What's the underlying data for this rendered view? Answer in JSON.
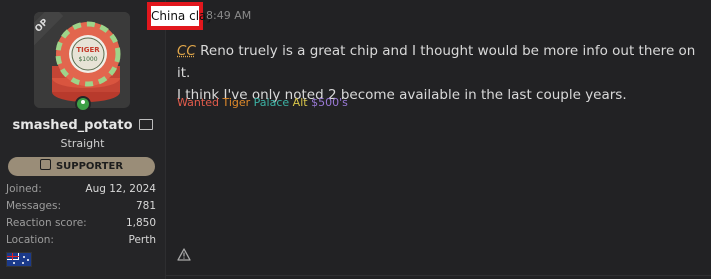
{
  "user": {
    "username": "smashed_potato",
    "title": "Straight",
    "op_label": "OP",
    "badge": "SUPPORTER",
    "stats": [
      {
        "label": "Joined:",
        "value": "Aug 12, 2024"
      },
      {
        "label": "Messages:",
        "value": "781"
      },
      {
        "label": "Reaction score:",
        "value": "1,850"
      },
      {
        "label": "Location:",
        "value": "Perth"
      }
    ],
    "flag": "australia-flag",
    "online": true
  },
  "post": {
    "tag": "China clay",
    "timestamp": "8:49 AM",
    "mention": "CC",
    "body_line1": " Reno truely is a great chip and I thought would be more info out there on it.",
    "body_line2": "I think I've only noted 2 become available in the last couple years.",
    "signature": {
      "wanted": "Wanted",
      "tiger": "Tiger",
      "palace": "Palace",
      "alt": "Alt",
      "price": "$500's"
    }
  },
  "colors": {
    "tag_border": "#e2171d",
    "badge_bg": "#9a8d78",
    "mention": "#e0a64a",
    "online": "#3da047"
  }
}
